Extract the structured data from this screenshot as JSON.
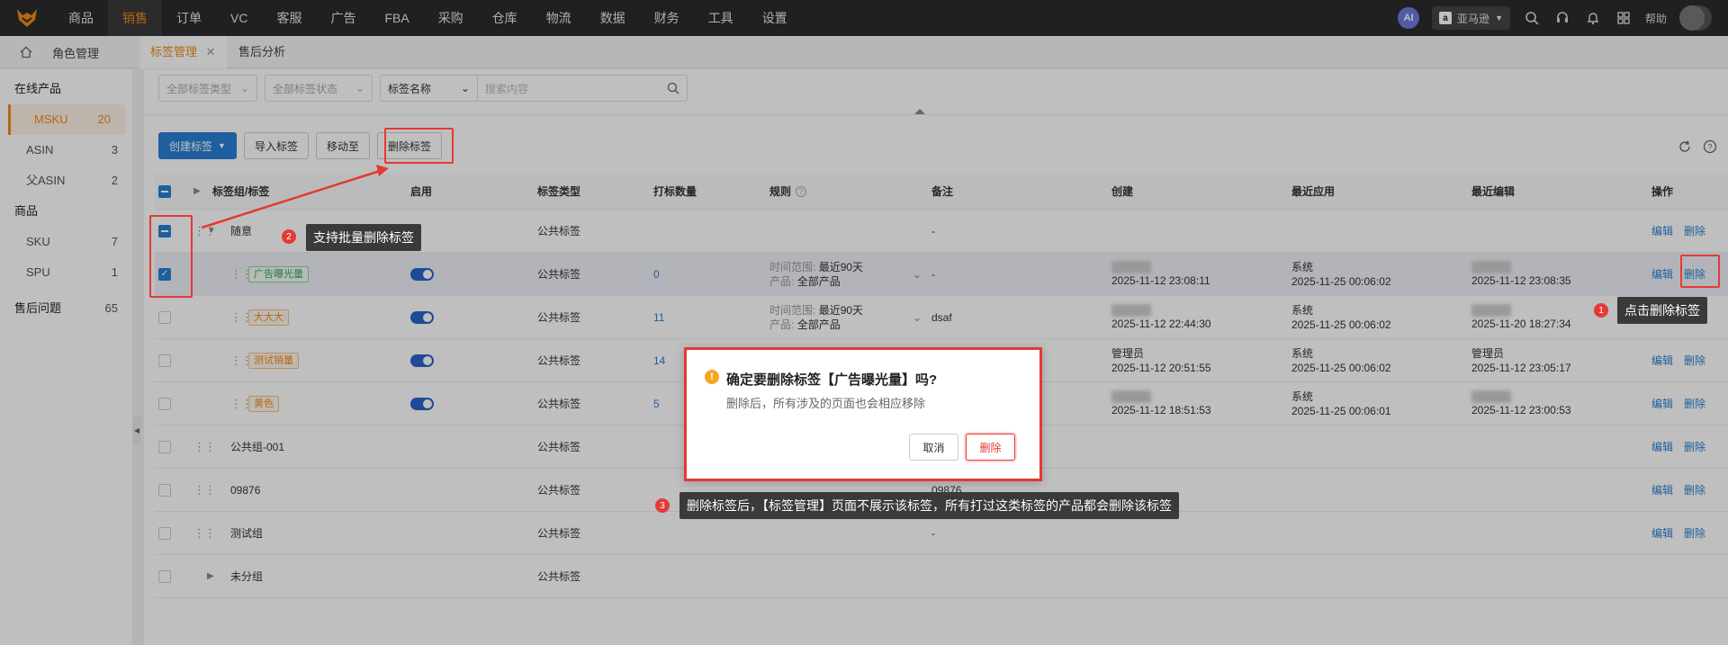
{
  "nav": {
    "items": [
      "商品",
      "销售",
      "订单",
      "VC",
      "客服",
      "广告",
      "FBA",
      "采购",
      "仓库",
      "物流",
      "数据",
      "财务",
      "工具",
      "设置"
    ],
    "ai": "AI",
    "store": "亚马逊",
    "help": "帮助"
  },
  "tabs": {
    "role": "角色管理",
    "tag_mgmt": "标签管理",
    "after_sale": "售后分析"
  },
  "sidebar": {
    "group1": "在线产品",
    "items1": [
      {
        "label": "MSKU",
        "count": "20"
      },
      {
        "label": "ASIN",
        "count": "3"
      },
      {
        "label": "父ASIN",
        "count": "2"
      }
    ],
    "group2": "商品",
    "items2": [
      {
        "label": "SKU",
        "count": "7"
      },
      {
        "label": "SPU",
        "count": "1"
      }
    ],
    "group3": {
      "label": "售后问题",
      "count": "65"
    }
  },
  "filters": {
    "type": "全部标签类型",
    "status": "全部标签状态",
    "key": "标签名称",
    "placeholder": "搜索内容"
  },
  "toolbar": {
    "create": "创建标签",
    "import": "导入标签",
    "move": "移动至",
    "delete": "删除标签"
  },
  "columns": {
    "name": "标签组/标签",
    "enabled": "启用",
    "type": "标签类型",
    "count": "打标数量",
    "rule": "规则",
    "note": "备注",
    "created": "创建",
    "last_applied": "最近应用",
    "last_edited": "最近编辑",
    "ops": "操作"
  },
  "rows": [
    {
      "name": "随意",
      "type": "公共标签",
      "note": "-",
      "edit": "编辑",
      "del": "删除"
    },
    {
      "tag": "广告曝光量",
      "type": "公共标签",
      "count": "0",
      "rule_l1": "时间范围:",
      "rule_v1": "最近90天",
      "rule_l2": "产品:",
      "rule_v2": "全部产品",
      "note": "-",
      "created": "2025-11-12 23:08:11",
      "applied_by": "系统",
      "applied": "2025-11-25 00:06:02",
      "edited": "2025-11-12 23:08:35",
      "edit": "编辑",
      "del": "删除"
    },
    {
      "tag": "大大大",
      "type": "公共标签",
      "count": "11",
      "rule_l1": "时间范围:",
      "rule_v1": "最近90天",
      "rule_l2": "产品:",
      "rule_v2": "全部产品",
      "note": "dsaf",
      "created": "2025-11-12 22:44:30",
      "applied_by": "系统",
      "applied": "2025-11-25 00:06:02",
      "edited": "2025-11-20 18:27:34",
      "edit": "编辑",
      "del": "删除"
    },
    {
      "tag": "测试销量",
      "type": "公共标签",
      "count": "14",
      "created_by": "管理员",
      "created": "2025-11-12 20:51:55",
      "applied_by": "系统",
      "applied": "2025-11-25 00:06:02",
      "edited_by": "管理员",
      "edited": "2025-11-12 23:05:17",
      "edit": "编辑",
      "del": "删除"
    },
    {
      "tag": "黄色",
      "type": "公共标签",
      "count": "5",
      "created": "2025-11-12 18:51:53",
      "applied_by": "系统",
      "applied": "2025-11-25 00:06:01",
      "edited": "2025-11-12 23:00:53",
      "edit": "编辑",
      "del": "删除"
    },
    {
      "name": "公共组-001",
      "type": "公共标签",
      "edit": "编辑",
      "del": "删除"
    },
    {
      "name": "09876",
      "type": "公共标签",
      "note": "09876",
      "edit": "编辑",
      "del": "删除"
    },
    {
      "name": "测试组",
      "type": "公共标签",
      "note": "-",
      "edit": "编辑",
      "del": "删除"
    },
    {
      "name": "未分组",
      "type": "公共标签"
    }
  ],
  "annotations": {
    "n1": "1",
    "t1": "点击删除标签",
    "n2": "2",
    "t2": "支持批量删除标签",
    "n3": "3",
    "t3": "删除标签后，【标签管理】页面不展示该标签，所有打过这类标签的产品都会删除该标签"
  },
  "dialog": {
    "title": "确定要删除标签【广告曝光量】吗?",
    "desc": "删除后，所有涉及的页面也会相应移除",
    "cancel": "取消",
    "confirm": "删除"
  },
  "colors": {
    "accent": "#f08a1c",
    "primary": "#2a7fd4",
    "danger": "#e53935"
  }
}
